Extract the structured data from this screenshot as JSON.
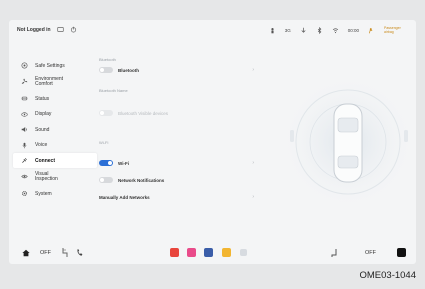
{
  "status_bar": {
    "user": "Not Logged in",
    "indicator_1": "3G",
    "time": "00:00",
    "badge": "Passenger airbag"
  },
  "sidebar": {
    "items": [
      {
        "label": "Safe Settings",
        "icon": "safety-icon"
      },
      {
        "label": "Environment Comfort",
        "icon": "fan-icon"
      },
      {
        "label": "Status",
        "icon": "car-status-icon"
      },
      {
        "label": "Display",
        "icon": "display-icon"
      },
      {
        "label": "Sound",
        "icon": "sound-icon"
      },
      {
        "label": "Voice",
        "icon": "voice-icon"
      },
      {
        "label": "Connect",
        "icon": "connect-icon",
        "active": true
      },
      {
        "label": "Visual Inspection",
        "icon": "eye-icon"
      },
      {
        "label": "System",
        "icon": "gear-icon"
      }
    ]
  },
  "content": {
    "bluetooth_section": "Bluetooth",
    "bluetooth_label": "Bluetooth",
    "bluetooth_on": false,
    "bluetooth_name_section": "Bluetooth Name",
    "bluetooth_visible_label": "Bluetooth Visible devices",
    "wifi_section": "Wi-Fi",
    "wifi_label": "Wi-Fi",
    "wifi_on": true,
    "network_notifications_label": "Network Notifications",
    "network_notifications_on": false,
    "manually_add_label": "Manually Add Networks"
  },
  "dock": {
    "left_temp": "OFF",
    "right_temp": "OFF"
  },
  "caption": "OME03-1044",
  "colors": {
    "accent": "#2b6fd6",
    "screen_bg": "#f4f5f6",
    "frame_bg": "#e6e7e8"
  }
}
